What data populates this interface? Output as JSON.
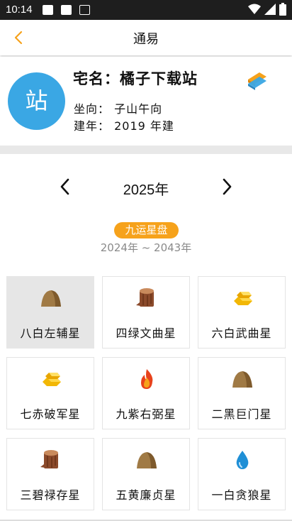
{
  "status_bar": {
    "time": "10:14"
  },
  "header": {
    "title": "通易"
  },
  "house": {
    "avatar_char": "站",
    "name": "宅名：橘子下载站",
    "orientation": "坐向：  子山午向",
    "built_year": "建年：  2019 年建"
  },
  "year_nav": {
    "year": "2025年"
  },
  "period": {
    "badge": "九运星盘",
    "range": "2024年 ~ 2043年"
  },
  "stars": [
    {
      "name": "八白左辅星",
      "icon": "mound-icon",
      "selected": true
    },
    {
      "name": "四绿文曲星",
      "icon": "wood-stump-icon",
      "selected": false
    },
    {
      "name": "六白武曲星",
      "icon": "gold-bars-icon",
      "selected": false
    },
    {
      "name": "七赤破军星",
      "icon": "gold-bars-icon",
      "selected": false
    },
    {
      "name": "九紫右弼星",
      "icon": "fire-icon",
      "selected": false
    },
    {
      "name": "二黑巨门星",
      "icon": "mound-icon",
      "selected": false
    },
    {
      "name": "三碧禄存星",
      "icon": "wood-stump-icon",
      "selected": false
    },
    {
      "name": "五黄廉贞星",
      "icon": "mound-icon",
      "selected": false
    },
    {
      "name": "一白贪狼星",
      "icon": "water-drop-icon",
      "selected": false
    }
  ],
  "colors": {
    "accent": "#f6a21b",
    "avatar": "#3aa7e4",
    "divider": "#e8e8e8"
  }
}
